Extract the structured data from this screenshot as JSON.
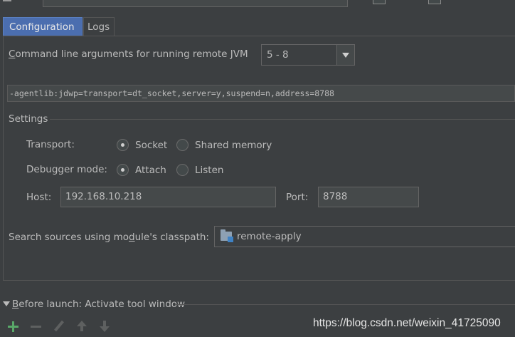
{
  "tabs": [
    {
      "label": "Configuration",
      "active": true
    },
    {
      "label": "Logs",
      "active": false
    }
  ],
  "command_line": {
    "label_mnemonic": "C",
    "label_rest": "ommand line arguments for running remote JVM",
    "jdk_version": "5 - 8",
    "args": "-agentlib:jdwp=transport=dt_socket,server=y,suspend=n,address=8788"
  },
  "settings": {
    "title": "Settings",
    "transport": {
      "label": "Transport:",
      "options": [
        {
          "label": "Socket",
          "selected": true
        },
        {
          "label": "Shared memory",
          "selected": false
        }
      ]
    },
    "debugger_mode": {
      "label": "Debugger mode:",
      "options": [
        {
          "label": "Attach",
          "selected": true
        },
        {
          "label": "Listen",
          "selected": false
        }
      ]
    },
    "host": {
      "label": "Host:",
      "value": "192.168.10.218"
    },
    "port": {
      "label": "Port:",
      "value": "8788"
    }
  },
  "classpath": {
    "label_pre": "Search sources using mo",
    "label_mnemonic": "d",
    "label_post": "ule's classpath:",
    "module": "remote-apply",
    "module_icon": "module-folder-icon"
  },
  "before_launch": {
    "label_mnemonic": "B",
    "label_rest": "efore launch: Activate tool window"
  },
  "toolbar_icons": [
    "plus-icon",
    "minus-icon",
    "pencil-icon",
    "arrow-up-icon",
    "arrow-down-icon"
  ],
  "watermark": "https://blog.csdn.net/weixin_41725090",
  "colors": {
    "background": "#3c3f41",
    "accent_tab": "#4b6eaf",
    "add_icon": "#59a869",
    "text": "#bbbbbb"
  }
}
